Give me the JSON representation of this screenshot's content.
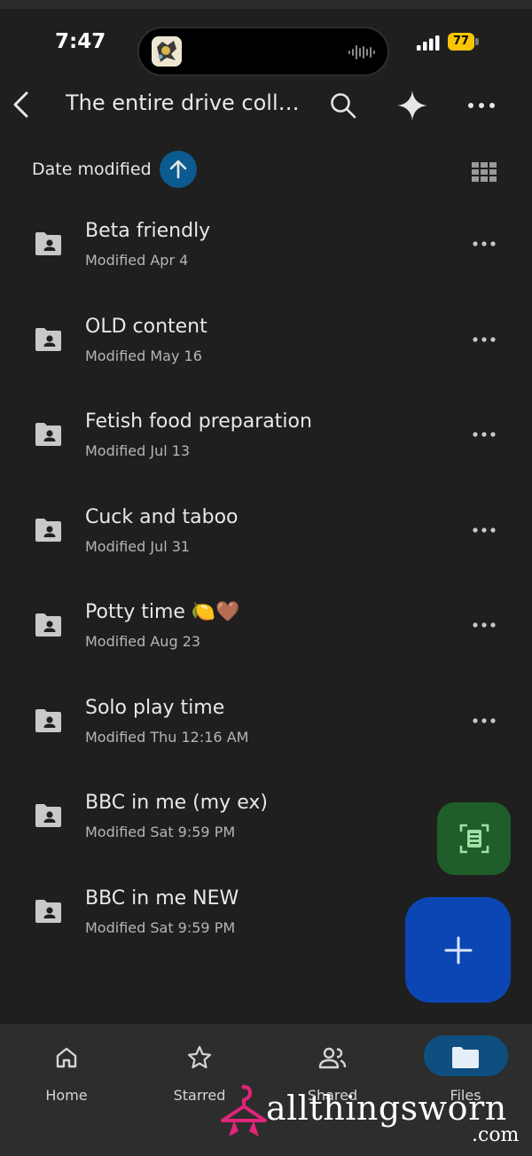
{
  "status_bar": {
    "time": "7:47",
    "battery": "77",
    "battery_color": "#f7c600"
  },
  "header": {
    "title": "The entire drive collection",
    "back_icon": "chevron-left-icon",
    "search_icon": "search-icon",
    "gemini_icon": "sparkle-icon",
    "more_icon": "more-horizontal-icon"
  },
  "sort": {
    "label": "Date modified",
    "direction_icon": "arrow-up-icon",
    "view_toggle_icon": "grid-view-icon",
    "accent": "#0b5a90"
  },
  "files": [
    {
      "name": "Beta friendly",
      "modified": "Modified Apr 4"
    },
    {
      "name": "OLD content",
      "modified": "Modified May 16"
    },
    {
      "name": "Fetish food preparation",
      "modified": "Modified Jul 13"
    },
    {
      "name": "Cuck and taboo",
      "modified": "Modified Jul 31"
    },
    {
      "name": "Potty time 🍋🤎",
      "modified": "Modified Aug 23"
    },
    {
      "name": "Solo play time",
      "modified": "Modified Thu 12:16 AM"
    },
    {
      "name": "BBC in me (my ex)",
      "modified": "Modified Sat 9:59 PM"
    },
    {
      "name": "BBC in me NEW",
      "modified": "Modified Sat 9:59 PM"
    }
  ],
  "fab": {
    "scan_icon": "document-scan-icon",
    "scan_color": "#1f5e2a",
    "add_icon": "plus-icon",
    "add_color": "#0b46b4"
  },
  "bottom_nav": [
    {
      "label": "Home",
      "icon": "home-icon"
    },
    {
      "label": "Starred",
      "icon": "star-icon"
    },
    {
      "label": "Shared",
      "icon": "people-icon"
    },
    {
      "label": "Files",
      "icon": "folder-icon",
      "selected": true
    }
  ],
  "watermark": {
    "text": "allthingsworn",
    "suffix": ".com",
    "logo": "hanger-logo"
  }
}
